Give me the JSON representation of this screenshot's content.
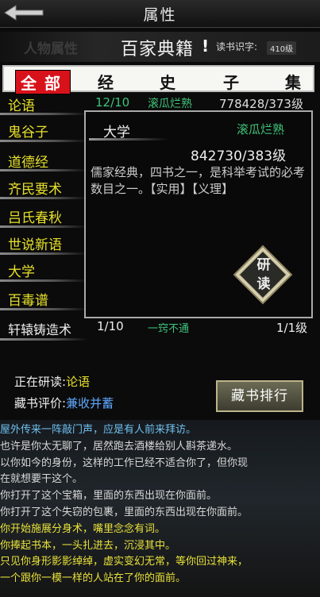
{
  "header": {
    "title": "属性",
    "ghost_label": "人物属性",
    "book_name": "百家典籍",
    "alert_mark": "!",
    "literacy_label": "读书识字:",
    "literacy_value": "410级"
  },
  "tabs": [
    "全部",
    "经",
    "史",
    "子",
    "集"
  ],
  "books": [
    {
      "name": "论语",
      "progress": "12/10",
      "status": "滚瓜烂熟",
      "value": "778428/373级"
    },
    {
      "name": "鬼谷子"
    },
    {
      "name": "道德经"
    },
    {
      "name": "齐民要术"
    },
    {
      "name": "吕氏春秋"
    },
    {
      "name": "世说新语"
    },
    {
      "name": "大学"
    },
    {
      "name": "百毒谱"
    },
    {
      "name": "轩辕铸造术",
      "progress": "1/10",
      "status": "一窍不通",
      "value": "1/1级"
    }
  ],
  "popup": {
    "title": "大学",
    "status": "滚瓜烂熟",
    "value": "842730/383级",
    "description": "儒家经典，四书之一，是科举考试的必考数目之一。【实用】【义理】",
    "study_button": "研读"
  },
  "info": {
    "studying_label": "正在研读:",
    "studying_value": "论语",
    "eval_label": "藏书评价:",
    "eval_value": "兼收并蓄",
    "rank_button": "藏书排行"
  },
  "log": [
    {
      "text": "屋外传来一阵敲门声，应是有人前来拜访。",
      "color": "#6fc0f0"
    },
    {
      "text": "也许是你太无聊了，居然跑去酒楼给别人斟茶递水。",
      "color": "#d8d8d8"
    },
    {
      "text": "以你如今的身份，这样的工作已经不适合你了，但你现",
      "color": "#d8d8d8"
    },
    {
      "text": "在就想要干这个。",
      "color": "#d8d8d8"
    },
    {
      "text": "你打开了这个宝箱，里面的东西出现在你面前。",
      "color": "#d8d8d8"
    },
    {
      "text": "你打开了这个失窃的包裹，里面的东西出现在你面前。",
      "color": "#d8d8d8"
    },
    {
      "text": "你开始施展分身术，嘴里念念有词。",
      "color": "#e8e23a"
    },
    {
      "text": "你捧起书本，一头扎进去，沉浸其中。",
      "color": "#e8e23a"
    },
    {
      "text": "只见你身形影影绰绰，虚实变幻无常，等你回过神来，",
      "color": "#e8e23a"
    },
    {
      "text": "一个跟你一模一样的人站在了你的面前。",
      "color": "#e8e23a"
    }
  ]
}
